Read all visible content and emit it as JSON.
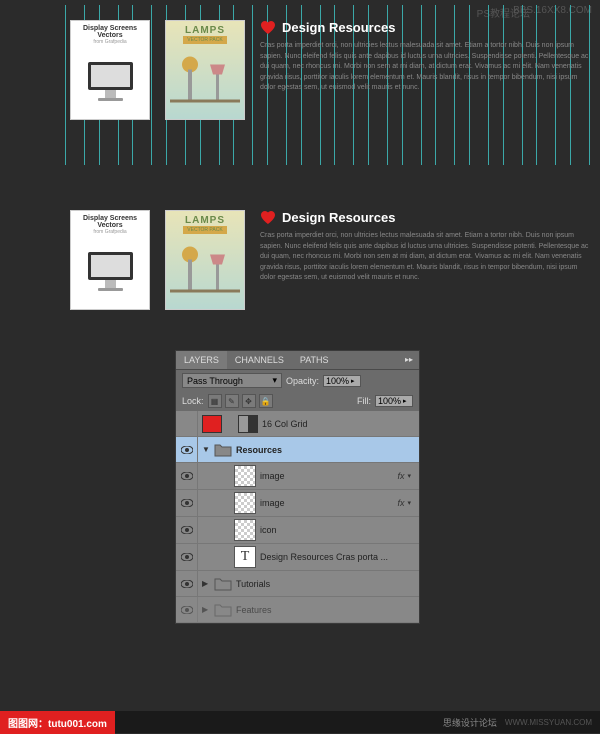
{
  "watermarks": {
    "tl": "PS教程论坛",
    "tr": "BBS.16XX8.COM"
  },
  "cards": {
    "display": {
      "title": "Display Screens Vectors",
      "sub": "from Grafpedia"
    },
    "lamps": {
      "title": "LAMPS",
      "sub": "VECTOR PACK"
    }
  },
  "resource": {
    "heading": "Design Resources",
    "body": "Cras porta imperdiet orci, non ultricies lectus malesuada sit amet. Etiam a tortor nibh. Duis non ipsum sapien. Nunc eleifend felis quis ante dapibus id luctus urna ultricies. Suspendisse potenti. Pellentesque ac dui quam, nec rhoncus mi. Morbi non sem at mi diam, at dictum erat. Vivamus ac mi elit. Nam venenatis gravida risus, porttitor iaculis lorem elementum et. Mauris blandit, risus in tempor bibendum, nisi ipsum dolor egestas sem, ut euismod velit mauris et nunc."
  },
  "panel": {
    "tabs": [
      "LAYERS",
      "CHANNELS",
      "PATHS"
    ],
    "blend": "Pass Through",
    "opacity_label": "Opacity:",
    "opacity": "100%",
    "lock_label": "Lock:",
    "fill_label": "Fill:",
    "fill": "100%",
    "layers": [
      {
        "name": "16 Col Grid"
      },
      {
        "name": "Resources"
      },
      {
        "name": "image"
      },
      {
        "name": "image"
      },
      {
        "name": "icon"
      },
      {
        "name": "Design Resources  Cras porta ..."
      },
      {
        "name": "Tutorials"
      },
      {
        "name": "Features"
      }
    ],
    "fx": "fx"
  },
  "footer": {
    "left": "图图网：tutu001.com",
    "mid": "思缘设计论坛",
    "right": "WWW.MISSYUAN.COM"
  }
}
